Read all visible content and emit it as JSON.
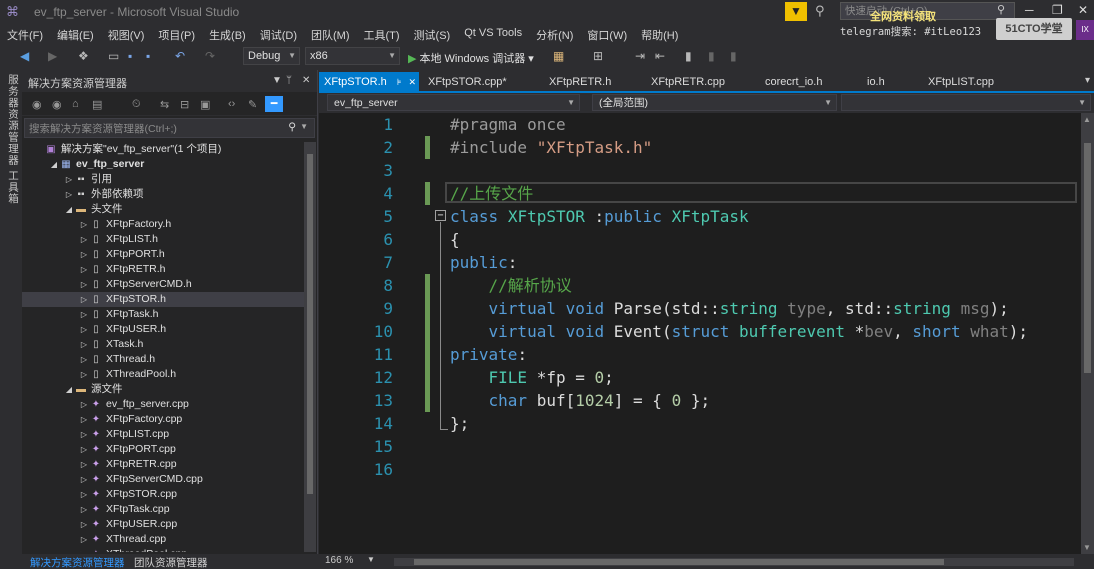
{
  "window": {
    "title": "ev_ftp_server - Microsoft Visual Studio",
    "quick_launch_placeholder": "快速启动 (Ctrl+Q)",
    "overlay_text1": "全网资料领取",
    "overlay_text2": "telegram搜索: #itLeo123",
    "brand": "51CTO学堂",
    "tag": "IX"
  },
  "menu": [
    "文件(F)",
    "编辑(E)",
    "视图(V)",
    "项目(P)",
    "生成(B)",
    "调试(D)",
    "团队(M)",
    "工具(T)",
    "测试(S)",
    "Qt VS Tools",
    "分析(N)",
    "窗口(W)",
    "帮助(H)"
  ],
  "toolbar": {
    "config": "Debug",
    "platform": "x86",
    "run_label": "本地 Windows 调试器"
  },
  "side_tabs": [
    "服务器资源管理器",
    "工具箱"
  ],
  "solution_explorer": {
    "title": "解决方案资源管理器",
    "search_placeholder": "搜索解决方案资源管理器(Ctrl+;)",
    "tree": [
      {
        "label": "解决方案\"ev_ftp_server\"(1 个项目)",
        "level": 0,
        "type": "sol",
        "expand": ""
      },
      {
        "label": "ev_ftp_server",
        "level": 1,
        "type": "proj",
        "expand": "open",
        "bold": true
      },
      {
        "label": "引用",
        "level": 2,
        "type": "ref",
        "expand": "closed"
      },
      {
        "label": "外部依赖项",
        "level": 2,
        "type": "ref",
        "expand": "closed"
      },
      {
        "label": "头文件",
        "level": 2,
        "type": "folder",
        "expand": "open"
      },
      {
        "label": "XFtpFactory.h",
        "level": 3,
        "type": "h",
        "expand": "closed"
      },
      {
        "label": "XFtpLIST.h",
        "level": 3,
        "type": "h",
        "expand": "closed"
      },
      {
        "label": "XFtpPORT.h",
        "level": 3,
        "type": "h",
        "expand": "closed"
      },
      {
        "label": "XFtpRETR.h",
        "level": 3,
        "type": "h",
        "expand": "closed"
      },
      {
        "label": "XFtpServerCMD.h",
        "level": 3,
        "type": "h",
        "expand": "closed"
      },
      {
        "label": "XFtpSTOR.h",
        "level": 3,
        "type": "h",
        "expand": "closed",
        "selected": true
      },
      {
        "label": "XFtpTask.h",
        "level": 3,
        "type": "h",
        "expand": "closed"
      },
      {
        "label": "XFtpUSER.h",
        "level": 3,
        "type": "h",
        "expand": "closed"
      },
      {
        "label": "XTask.h",
        "level": 3,
        "type": "h",
        "expand": "closed"
      },
      {
        "label": "XThread.h",
        "level": 3,
        "type": "h",
        "expand": "closed"
      },
      {
        "label": "XThreadPool.h",
        "level": 3,
        "type": "h",
        "expand": "closed"
      },
      {
        "label": "源文件",
        "level": 2,
        "type": "folder",
        "expand": "open"
      },
      {
        "label": "ev_ftp_server.cpp",
        "level": 3,
        "type": "cpp",
        "expand": "closed"
      },
      {
        "label": "XFtpFactory.cpp",
        "level": 3,
        "type": "cpp",
        "expand": "closed"
      },
      {
        "label": "XFtpLIST.cpp",
        "level": 3,
        "type": "cpp",
        "expand": "closed"
      },
      {
        "label": "XFtpPORT.cpp",
        "level": 3,
        "type": "cpp",
        "expand": "closed"
      },
      {
        "label": "XFtpRETR.cpp",
        "level": 3,
        "type": "cpp",
        "expand": "closed"
      },
      {
        "label": "XFtpServerCMD.cpp",
        "level": 3,
        "type": "cpp",
        "expand": "closed"
      },
      {
        "label": "XFtpSTOR.cpp",
        "level": 3,
        "type": "cpp",
        "expand": "closed"
      },
      {
        "label": "XFtpTask.cpp",
        "level": 3,
        "type": "cpp",
        "expand": "closed"
      },
      {
        "label": "XFtpUSER.cpp",
        "level": 3,
        "type": "cpp",
        "expand": "closed"
      },
      {
        "label": "XThread.cpp",
        "level": 3,
        "type": "cpp",
        "expand": "closed"
      },
      {
        "label": "XThreadPool.cpp",
        "level": 3,
        "type": "cpp",
        "expand": "closed"
      }
    ],
    "bottom_tabs": [
      "解决方案资源管理器",
      "团队资源管理器"
    ]
  },
  "editor": {
    "tabs": [
      {
        "label": "XFtpSTOR.h",
        "active": true
      },
      {
        "label": "XFtpSTOR.cpp*",
        "active": false
      },
      {
        "label": "XFtpRETR.h",
        "active": false
      },
      {
        "label": "XFtpRETR.cpp",
        "active": false
      },
      {
        "label": "corecrt_io.h",
        "active": false
      },
      {
        "label": "io.h",
        "active": false
      },
      {
        "label": "XFtpLIST.cpp",
        "active": false
      }
    ],
    "nav_project": "ev_ftp_server",
    "nav_scope": "(全局范围)",
    "zoom": "166 %",
    "line_numbers": [
      "1",
      "2",
      "3",
      "4",
      "5",
      "6",
      "7",
      "8",
      "9",
      "10",
      "11",
      "12",
      "13",
      "14",
      "15",
      "16"
    ]
  },
  "colors": {
    "accent": "#007acc",
    "background": "#1e1e1e",
    "line_number": "#2b91af",
    "keyword": "#569cd6",
    "type": "#4ec9b0",
    "comment": "#57a64a",
    "string": "#d69d85"
  }
}
